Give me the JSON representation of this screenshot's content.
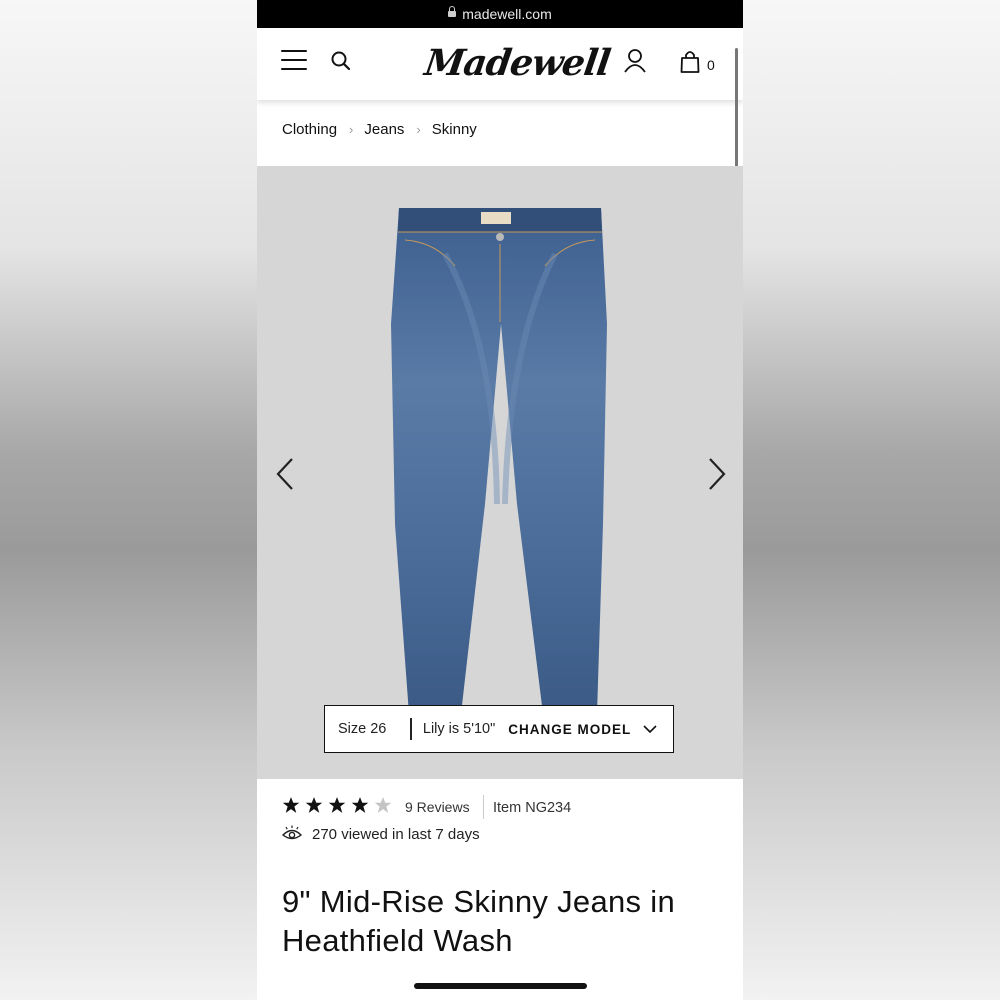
{
  "browser": {
    "url": "madewell.com"
  },
  "header": {
    "logo": "Madewell",
    "bag_count": "0",
    "icons": [
      "menu-icon",
      "search-icon",
      "account-icon",
      "bag-icon"
    ]
  },
  "breadcrumb": [
    "Clothing",
    "Jeans",
    "Skinny"
  ],
  "gallery": {
    "model_size": "Size 26",
    "model_height": "Lily is 5'10\"",
    "change_model_label": "CHANGE MODEL"
  },
  "product": {
    "rating": 4,
    "rating_max": 5,
    "reviews_label": "9 Reviews",
    "item_number": "Item NG234",
    "viewed_text": "270 viewed in last 7 days",
    "title": "9\" Mid-Rise Skinny Jeans in Heathfield Wash"
  },
  "colors": {
    "denim": "#4f6f9a",
    "gallery_bg": "#d6d6d6",
    "star_filled": "#111111",
    "star_empty": "#c4c4c4"
  }
}
